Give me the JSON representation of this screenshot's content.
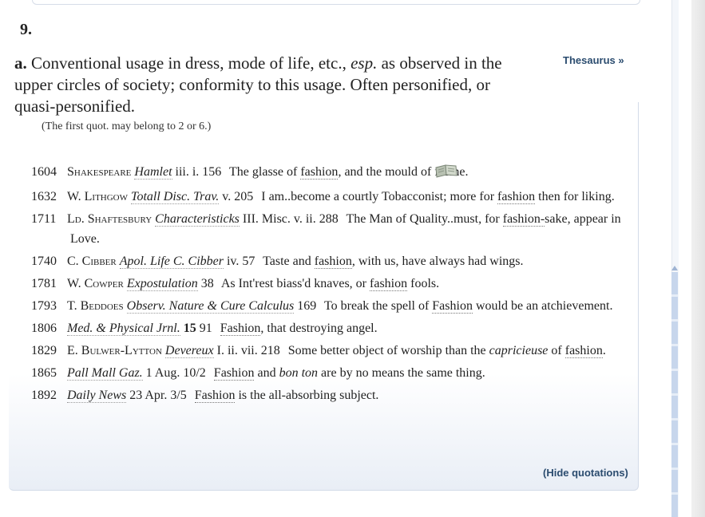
{
  "sense": {
    "number": "9.",
    "sub_label": "a.",
    "definition_part1": "Conventional usage in dress, mode of life, etc., ",
    "definition_esp": "esp.",
    "definition_part2": " as observed in the upper circles of society; conformity to this usage. Often personified, or quasi-personified.",
    "note": "(The first quot. may belong to 2 or 6.)",
    "thesaurus_link": "Thesaurus »"
  },
  "quotations": [
    {
      "year": "1604",
      "author": "Shakespeare",
      "title": "Hamlet",
      "ref": "iii. i. 156",
      "text_before": "The glasse of ",
      "keyword": "fashion",
      "text_after": ", and the mould of forme."
    },
    {
      "year": "1632",
      "author": "W. Lithgow",
      "title": "Totall Disc. Trav.",
      "ref": "v. 205",
      "text_before": "I am..become a courtly Tobacconist; more for ",
      "keyword": "fashion",
      "text_after": " then for liking."
    },
    {
      "year": "1711",
      "author": "Ld. Shaftesbury",
      "title": "Characteristicks",
      "ref": "III. Misc. v. ii. 288",
      "text_before": "The Man of Quality..must, for ",
      "keyword": "fashion-",
      "text_after": "sake, appear in Love."
    },
    {
      "year": "1740",
      "author": "C. Cibber",
      "title": "Apol. Life C. Cibber",
      "ref": "iv. 57",
      "text_before": "Taste and ",
      "keyword": "fashion",
      "text_after": ", with us, have always had wings."
    },
    {
      "year": "1781",
      "author": "W. Cowper",
      "title": "Expostulation",
      "ref": "38",
      "text_before": "As Int'rest biass'd knaves, or ",
      "keyword": "fashion",
      "text_after": " fools."
    },
    {
      "year": "1793",
      "author": "T. Beddoes",
      "title": "Observ. Nature & Cure Calculus",
      "ref": "169",
      "text_before": "To break the spell of ",
      "keyword": "Fashion",
      "text_after": " would be an atchievement."
    },
    {
      "year": "1806",
      "author": "",
      "title": "Med. & Physical Jrnl.",
      "vol": "15",
      "ref": "91",
      "text_before": "",
      "keyword": "Fashion",
      "text_after": ", that destroying angel."
    },
    {
      "year": "1829",
      "author": "E. Bulwer-Lytton",
      "title": "Devereux",
      "ref": "I. ii. vii. 218",
      "text_before": "Some better object of worship than the ",
      "em_text": "capricieuse",
      "text_mid": " of ",
      "keyword": "fashion",
      "text_after": "."
    },
    {
      "year": "1865",
      "author": "",
      "title": "Pall Mall Gaz.",
      "ref": "1 Aug. 10/2",
      "text_before": "",
      "keyword": "Fashion",
      "text_mid2": " and ",
      "em_text2": "bon ton",
      "text_after": " are by no means the same thing."
    },
    {
      "year": "1892",
      "author": "",
      "title": "Daily News",
      "ref": "23 Apr. 3/5",
      "text_before": "",
      "keyword": "Fashion",
      "text_after": " is the all-absorbing subject."
    }
  ],
  "hide_quotations": "(Hide quotations)",
  "icons": {
    "book": "open-book-icon"
  },
  "colors": {
    "link": "#2b4c6f",
    "panel_border": "#d3dbe8",
    "scroll_thumb": "#c7d6ec"
  }
}
